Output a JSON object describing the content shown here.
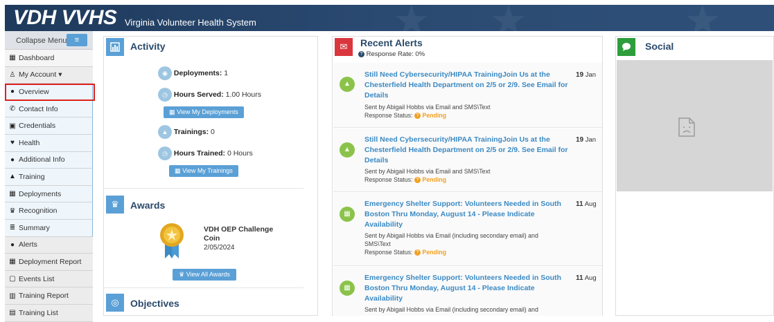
{
  "header": {
    "brand": "VDH VVHS",
    "subtitle": "Virginia Volunteer Health System"
  },
  "sidebar": {
    "collapse_label": "Collapse Menu",
    "collapse_icon": "≡",
    "items": [
      {
        "label": "Dashboard",
        "icon": "▦"
      },
      {
        "label": "My Account ▾",
        "icon": "♙"
      },
      {
        "label": "Overview",
        "icon": "●"
      },
      {
        "label": "Contact Info",
        "icon": "✆"
      },
      {
        "label": "Credentials",
        "icon": "▣"
      },
      {
        "label": "Health",
        "icon": "♥"
      },
      {
        "label": "Additional Info",
        "icon": "●"
      },
      {
        "label": "Training",
        "icon": "▲"
      },
      {
        "label": "Deployments",
        "icon": "▦"
      },
      {
        "label": "Recognition",
        "icon": "♛"
      },
      {
        "label": "Summary",
        "icon": "≣"
      },
      {
        "label": "Alerts",
        "icon": "●"
      },
      {
        "label": "Deployment Report",
        "icon": "▦"
      },
      {
        "label": "Events List",
        "icon": "▢"
      },
      {
        "label": "Training Report",
        "icon": "▥"
      },
      {
        "label": "Training List",
        "icon": "▤"
      }
    ]
  },
  "activity": {
    "title": "Activity",
    "deployments_label": "Deployments:",
    "deployments_value": "1",
    "hours_served_label": "Hours Served:",
    "hours_served_value": "1.00 Hours",
    "view_deployments": "View My Deployments",
    "trainings_label": "Trainings:",
    "trainings_value": "0",
    "hours_trained_label": "Hours Trained:",
    "hours_trained_value": "0 Hours",
    "view_trainings": "View My Trainings"
  },
  "awards": {
    "title": "Awards",
    "award_name_line1": "VDH OEP Challenge",
    "award_name_line2": "Coin",
    "award_date": "2/05/2024",
    "view_all": "View All Awards"
  },
  "objectives": {
    "title": "Objectives"
  },
  "alerts": {
    "title": "Recent Alerts",
    "response_rate": "Response Rate: 0%",
    "items": [
      {
        "line1": "Still Need Cybersecurity/HIPAA TrainingJoin Us at the",
        "line2": "Chesterfield Health Department on 2/5 or 2/9. See Email for",
        "line3": "Details",
        "day": "19",
        "month": "Jan",
        "sent": "Sent by Abigail Hobbs via Email and SMS\\Text",
        "status_label": "Response Status:",
        "status": "Pending"
      },
      {
        "line1": "Still Need Cybersecurity/HIPAA TrainingJoin Us at the",
        "line2": "Chesterfield Health Department on 2/5 or 2/9. See Email for",
        "line3": "Details",
        "day": "19",
        "month": "Jan",
        "sent": "Sent by Abigail Hobbs via Email and SMS\\Text",
        "status_label": "Response Status:",
        "status": "Pending"
      },
      {
        "line1": "Emergency Shelter Support: Volunteers Needed in South",
        "line2": "Boston Thru Monday, August 14 - Please Indicate",
        "line3": "Availability",
        "day": "11",
        "month": "Aug",
        "sent": "Sent by Abigail Hobbs via Email (including secondary email) and",
        "sent2": "SMS\\Text",
        "status_label": "Response Status:",
        "status": "Pending"
      },
      {
        "line1": "Emergency Shelter Support: Volunteers Needed in South",
        "line2": "Boston Thru Monday, August 14 - Please Indicate",
        "line3": "Availability",
        "day": "11",
        "month": "Aug",
        "sent": "Sent by Abigail Hobbs via Email (including secondary email) and"
      }
    ]
  },
  "social": {
    "title": "Social"
  },
  "colors": {
    "header": "#1e3a5c",
    "accent_blue": "#5aa0d6",
    "alert_red": "#d9363e",
    "social_green": "#2e9d3c",
    "pending": "#f0a020",
    "link": "#3b8ac4"
  }
}
